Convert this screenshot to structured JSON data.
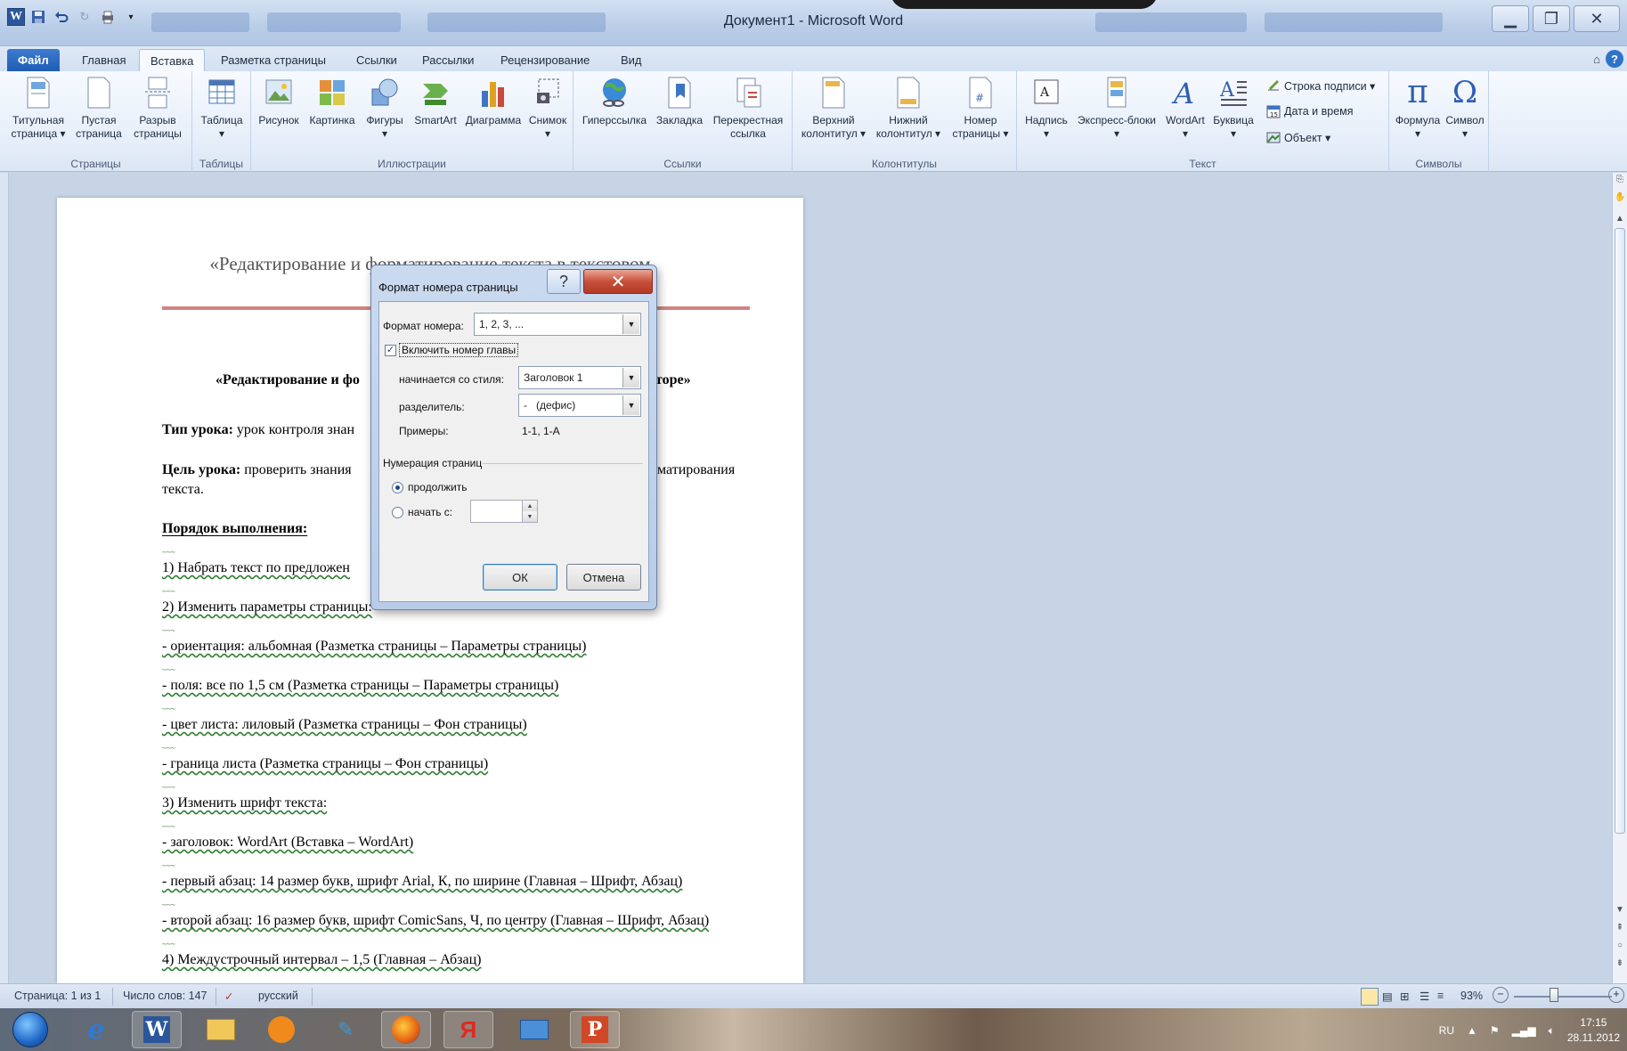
{
  "window": {
    "title": "Документ1 - Microsoft Word"
  },
  "tabs": [
    "Файл",
    "Главная",
    "Вставка",
    "Разметка страницы",
    "Ссылки",
    "Рассылки",
    "Рецензирование",
    "Вид"
  ],
  "active_tab": "Вставка",
  "ribbon": {
    "pages": {
      "label": "Страницы",
      "title_page": "Титульная\nстраница ▾",
      "blank_page": "Пустая\nстраница",
      "page_break": "Разрыв\nстраницы"
    },
    "tables": {
      "label": "Таблицы",
      "table": "Таблица\n▾"
    },
    "illustrations": {
      "label": "Иллюстрации",
      "picture": "Рисунок",
      "clipart": "Картинка",
      "shapes": "Фигуры\n▾",
      "smartart": "SmartArt",
      "chart": "Диаграмма",
      "screenshot": "Снимок\n▾"
    },
    "links": {
      "label": "Ссылки",
      "hyperlink": "Гиперссылка",
      "bookmark": "Закладка",
      "crossref": "Перекрестная\nссылка"
    },
    "headers": {
      "label": "Колонтитулы",
      "header": "Верхний\nколонтитул ▾",
      "footer": "Нижний\nколонтитул ▾",
      "page_number": "Номер\nстраницы ▾"
    },
    "text": {
      "label": "Текст",
      "textbox": "Надпись\n▾",
      "quickparts": "Экспресс-блоки\n▾",
      "wordart": "WordArt\n▾",
      "dropcap": "Буквица\n▾",
      "signature_line": "Строка подписи ▾",
      "date_time": "Дата и время",
      "object": "Объект ▾"
    },
    "symbols": {
      "label": "Символы",
      "equation": "Формула\n▾",
      "symbol": "Символ\n▾"
    }
  },
  "document": {
    "title_line": "«Редактирование и форматирование текста в текстовом",
    "heading": "«Редактирование и форматирование текста в текстовом редакторе»",
    "heading_left": "«Редактирование и фо",
    "heading_right": "торе»",
    "lesson_type_label": "Тип урока:",
    "lesson_type_value": " урок контроля знан",
    "goal_label": "Цель урока:",
    "goal_value": " проверить знания",
    "goal_tail": "матирования",
    "goal_line2": "текста.",
    "procedure": "Порядок выполнения:",
    "step1": "1) Набрать текст по предложен",
    "step2": "2) Изменить параметры страницы:",
    "item_orientation": "- ориентация:  альбомная (Разметка страницы – Параметры страницы)",
    "item_margins": "- поля:  все по 1,5 см (Разметка страницы – Параметры страницы)",
    "item_color": "- цвет листа: лиловый (Разметка страницы – Фон страницы)",
    "item_border": "- граница   листа  (Разметка страницы – Фон страницы)",
    "step3": "3) Изменить шрифт текста:",
    "item_heading": "- заголовок: WordArt (Вставка – WordArt)",
    "item_p1": "- первый абзац: 14 размер букв, шрифт Arial, К, по ширине (Главная – Шрифт, Абзац)",
    "item_p2": "- второй абзац: 16 размер букв, шрифт ComicSans, Ч, по центру (Главная – Шрифт, Абзац)",
    "step4": "4) Междустрочный интервал – 1,5 (Главная – Абзац)"
  },
  "dialog": {
    "title": "Формат номера страницы",
    "number_format_label": "Формат номера:",
    "number_format_value": "1, 2, 3, ...",
    "include_chapter_label": "Включить номер главы",
    "include_chapter_checked": true,
    "starts_with_label": "начинается со стиля:",
    "starts_with_value": "Заголовок 1",
    "separator_label": "разделитель:",
    "separator_value": "-   (дефис)",
    "examples_label": "Примеры:",
    "examples_value": "1-1, 1-A",
    "numbering_section": "Нумерация страниц",
    "continue_label": "продолжить",
    "start_at_label": "начать с:",
    "start_at_value": "",
    "ok": "ОК",
    "cancel": "Отмена"
  },
  "status": {
    "page": "Страница: 1 из 1",
    "words": "Число слов: 147",
    "language": "русский",
    "zoom": "93%"
  },
  "taskbar": {
    "lang": "RU",
    "time": "17:15",
    "date": "28.11.2012"
  },
  "colors": {
    "title_rule": "#c0504d",
    "file_tab": "#2b66c0",
    "close_button": "#c8503b"
  }
}
